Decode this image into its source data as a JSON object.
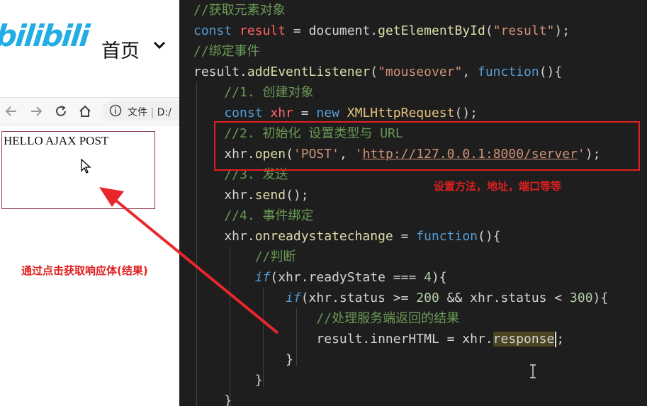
{
  "header": {
    "logo_text": "bilibili",
    "home_label": "首页"
  },
  "browser": {
    "address_prefix": "文件",
    "address_text": "D:/",
    "result_text": "HELLO AJAX POST"
  },
  "annotations": {
    "left_note": "通过点击获取响应体(结果)",
    "right_note": "设置方法，地址，端口等等"
  },
  "code": {
    "lines": [
      {
        "tokens": [
          [
            "cm",
            "//获取元素对象"
          ]
        ]
      },
      {
        "tokens": [
          [
            "kw",
            "const "
          ],
          [
            "var",
            "result"
          ],
          [
            "pl",
            " = "
          ],
          [
            "pl",
            "document."
          ],
          [
            "fn",
            "getElementById"
          ],
          [
            "pl",
            "("
          ],
          [
            "str",
            "\"result\""
          ],
          [
            "pl",
            ");"
          ]
        ]
      },
      {
        "tokens": [
          [
            "cm",
            "//绑定事件"
          ]
        ]
      },
      {
        "tokens": [
          [
            "pl",
            "result."
          ],
          [
            "fn",
            "addEventListener"
          ],
          [
            "pl",
            "("
          ],
          [
            "str",
            "\"mouseover\""
          ],
          [
            "pl",
            ", "
          ],
          [
            "kw",
            "function"
          ],
          [
            "pl",
            "(){"
          ]
        ]
      },
      {
        "tokens": [
          [
            "cm",
            "    //1. 创建对象"
          ]
        ]
      },
      {
        "tokens": [
          [
            "kw",
            "    const "
          ],
          [
            "var",
            "xhr"
          ],
          [
            "pl",
            " = "
          ],
          [
            "kw",
            "new "
          ],
          [
            "cls",
            "XMLHttpRequest"
          ],
          [
            "pl",
            "();"
          ]
        ]
      },
      {
        "tokens": [
          [
            "cm",
            "    //2. 初始化 设置类型与 URL"
          ]
        ]
      },
      {
        "tokens": [
          [
            "pl",
            "    xhr."
          ],
          [
            "fn",
            "open"
          ],
          [
            "pl",
            "("
          ],
          [
            "str",
            "'POST'"
          ],
          [
            "pl",
            ", "
          ],
          [
            "str",
            "'"
          ],
          [
            "str-u",
            "http://127.0.0.1:8000/server"
          ],
          [
            "str",
            "'"
          ],
          [
            "pl",
            ");"
          ]
        ]
      },
      {
        "tokens": [
          [
            "cm",
            "    //3. 发送"
          ]
        ]
      },
      {
        "tokens": [
          [
            "pl",
            "    xhr."
          ],
          [
            "fn",
            "send"
          ],
          [
            "pl",
            "();"
          ]
        ]
      },
      {
        "tokens": [
          [
            "cm",
            "    //4. 事件绑定"
          ]
        ]
      },
      {
        "tokens": [
          [
            "pl",
            "    xhr."
          ],
          [
            "fn",
            "onreadystatechange"
          ],
          [
            "pl",
            " = "
          ],
          [
            "kw",
            "function"
          ],
          [
            "pl",
            "(){"
          ]
        ]
      },
      {
        "tokens": [
          [
            "cm",
            "        //判断"
          ]
        ]
      },
      {
        "tokens": [
          [
            "kw-i",
            "        if"
          ],
          [
            "pl",
            "(xhr.readyState === "
          ],
          [
            "num",
            "4"
          ],
          [
            "pl",
            "){"
          ]
        ]
      },
      {
        "tokens": [
          [
            "kw-i",
            "            if"
          ],
          [
            "pl",
            "(xhr.status >= "
          ],
          [
            "num",
            "200"
          ],
          [
            "pl",
            " && xhr.status < "
          ],
          [
            "num",
            "300"
          ],
          [
            "pl",
            "){"
          ]
        ]
      },
      {
        "tokens": [
          [
            "cm",
            "                //处理服务端返回的结果"
          ]
        ]
      },
      {
        "tokens": [
          [
            "pl",
            "                result.innerHTML = xhr."
          ],
          [
            "hl",
            "response"
          ],
          [
            "caret",
            ""
          ],
          [
            "pl",
            ";"
          ]
        ]
      },
      {
        "tokens": [
          [
            "pl",
            "            }"
          ]
        ]
      },
      {
        "tokens": [
          [
            "pl",
            "        }"
          ]
        ]
      },
      {
        "tokens": [
          [
            "pl",
            "    }"
          ]
        ]
      }
    ]
  }
}
